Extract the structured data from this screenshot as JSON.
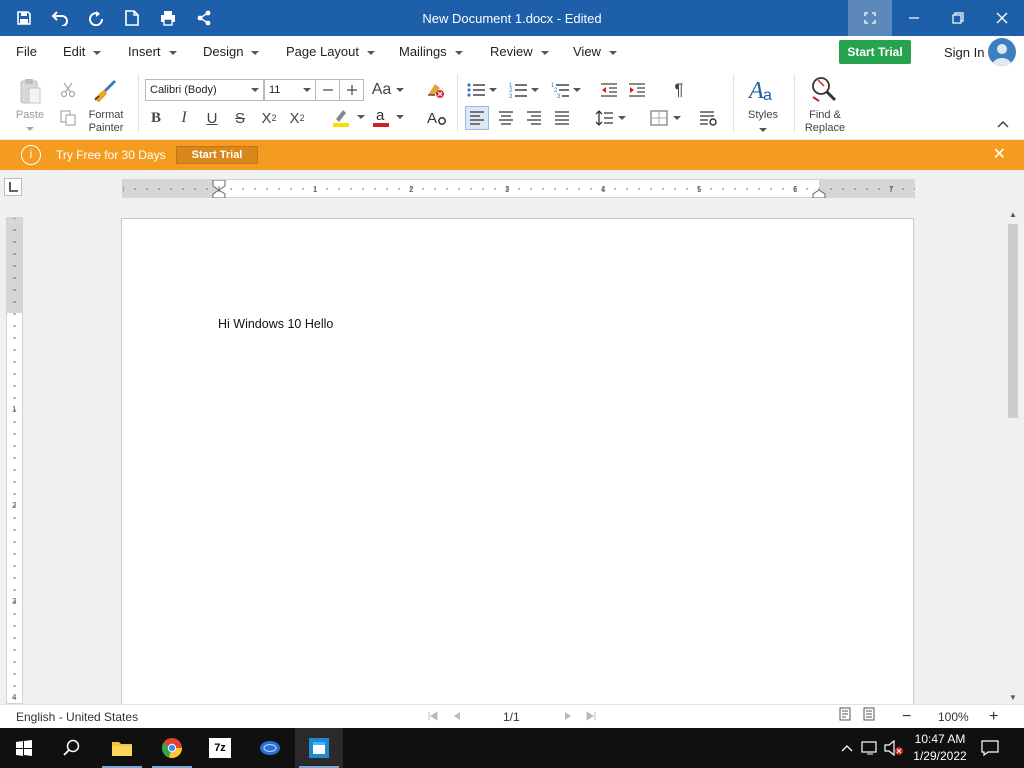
{
  "window": {
    "title": "New Document 1.docx - Edited",
    "quick_access": [
      "save-icon",
      "undo-icon",
      "redo-icon",
      "new-document-icon",
      "print-icon",
      "share-icon"
    ],
    "controls": [
      "fullscreen-icon",
      "minimize-icon",
      "restore-icon",
      "close-icon"
    ]
  },
  "menu": {
    "items": [
      "File",
      "Edit",
      "Insert",
      "Design",
      "Page Layout",
      "Mailings",
      "Review",
      "View"
    ],
    "start_trial": "Start Trial",
    "sign_in": "Sign In"
  },
  "ribbon": {
    "paste_label": "Paste",
    "format_painter_label": "Format Painter",
    "font_name": "Calibri (Body)",
    "font_size": "11",
    "styles_label": "Styles",
    "find_replace_label": "Find & Replace",
    "accent_color": "#1d5fa8",
    "highlight_color": "#f5e000",
    "font_color": "#d61f1f"
  },
  "banner": {
    "message": "Try Free for 30 Days",
    "button": "Start Trial",
    "color": "#f39c1f"
  },
  "ruler": {
    "h_numbers": [
      "1",
      "2",
      "3",
      "4",
      "5",
      "6",
      "7"
    ],
    "v_numbers": [
      "1",
      "2",
      "3",
      "4"
    ]
  },
  "document": {
    "text": "Hi Windows 10 Hello"
  },
  "status": {
    "language": "English - United States",
    "page": "1/1",
    "zoom": "100%"
  },
  "taskbar": {
    "time": "10:47 AM",
    "date": "1/29/2022"
  }
}
